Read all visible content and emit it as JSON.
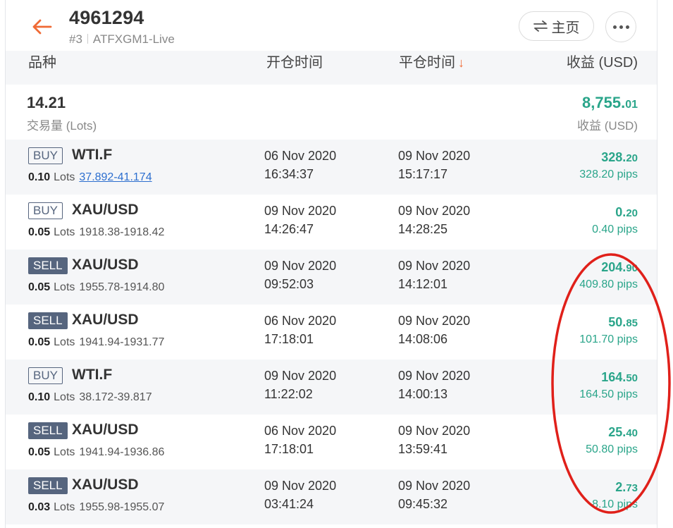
{
  "header": {
    "account_number": "4961294",
    "rank": "#3",
    "server": "ATFXGM1-Live",
    "home_label": "主页",
    "back_icon": "arrow-left-icon",
    "swap_icon": "swap-arrows-icon",
    "more_icon": "more-dots-icon",
    "accent_color": "#f06a35"
  },
  "columns": {
    "product": "品种",
    "open_time": "开仓时间",
    "close_time": "平仓时间",
    "close_sort_icon": "↓",
    "profit": "收益 (USD)"
  },
  "summary": {
    "lots": "14.21",
    "lots_label": "交易量 (Lots)",
    "profit_int": "8,755.",
    "profit_dec": "01",
    "profit_label": "收益 (USD)"
  },
  "labels": {
    "lots_unit": "Lots"
  },
  "colors": {
    "profit": "#2aa58a",
    "side_badge": "#56657e",
    "annotation": "#e0201a"
  },
  "trades": [
    {
      "side": "BUY",
      "symbol": "WTI.F",
      "lots": "0.10",
      "range": "37.892-41.174",
      "range_linked": true,
      "open_date": "06 Nov 2020",
      "open_time": "16:34:37",
      "close_date": "09 Nov 2020",
      "close_time": "15:17:17",
      "profit_int": "328.",
      "profit_dec": "20",
      "pips": "328.20 pips"
    },
    {
      "side": "BUY",
      "symbol": "XAU/USD",
      "lots": "0.05",
      "range": "1918.38-1918.42",
      "range_linked": false,
      "open_date": "09 Nov 2020",
      "open_time": "14:26:47",
      "close_date": "09 Nov 2020",
      "close_time": "14:28:25",
      "profit_int": "0.",
      "profit_dec": "20",
      "pips": "0.40 pips"
    },
    {
      "side": "SELL",
      "symbol": "XAU/USD",
      "lots": "0.05",
      "range": "1955.78-1914.80",
      "range_linked": false,
      "open_date": "09 Nov 2020",
      "open_time": "09:52:03",
      "close_date": "09 Nov 2020",
      "close_time": "14:12:01",
      "profit_int": "204.",
      "profit_dec": "90",
      "pips": "409.80 pips"
    },
    {
      "side": "SELL",
      "symbol": "XAU/USD",
      "lots": "0.05",
      "range": "1941.94-1931.77",
      "range_linked": false,
      "open_date": "06 Nov 2020",
      "open_time": "17:18:01",
      "close_date": "09 Nov 2020",
      "close_time": "14:08:06",
      "profit_int": "50.",
      "profit_dec": "85",
      "pips": "101.70 pips"
    },
    {
      "side": "BUY",
      "symbol": "WTI.F",
      "lots": "0.10",
      "range": "38.172-39.817",
      "range_linked": false,
      "open_date": "09 Nov 2020",
      "open_time": "11:22:02",
      "close_date": "09 Nov 2020",
      "close_time": "14:00:13",
      "profit_int": "164.",
      "profit_dec": "50",
      "pips": "164.50 pips"
    },
    {
      "side": "SELL",
      "symbol": "XAU/USD",
      "lots": "0.05",
      "range": "1941.94-1936.86",
      "range_linked": false,
      "open_date": "06 Nov 2020",
      "open_time": "17:18:01",
      "close_date": "09 Nov 2020",
      "close_time": "13:59:41",
      "profit_int": "25.",
      "profit_dec": "40",
      "pips": "50.80 pips"
    },
    {
      "side": "SELL",
      "symbol": "XAU/USD",
      "lots": "0.03",
      "range": "1955.98-1955.07",
      "range_linked": false,
      "open_date": "09 Nov 2020",
      "open_time": "03:41:24",
      "close_date": "09 Nov 2020",
      "close_time": "09:45:32",
      "profit_int": "2.",
      "profit_dec": "73",
      "pips": "8.10 pips"
    }
  ]
}
